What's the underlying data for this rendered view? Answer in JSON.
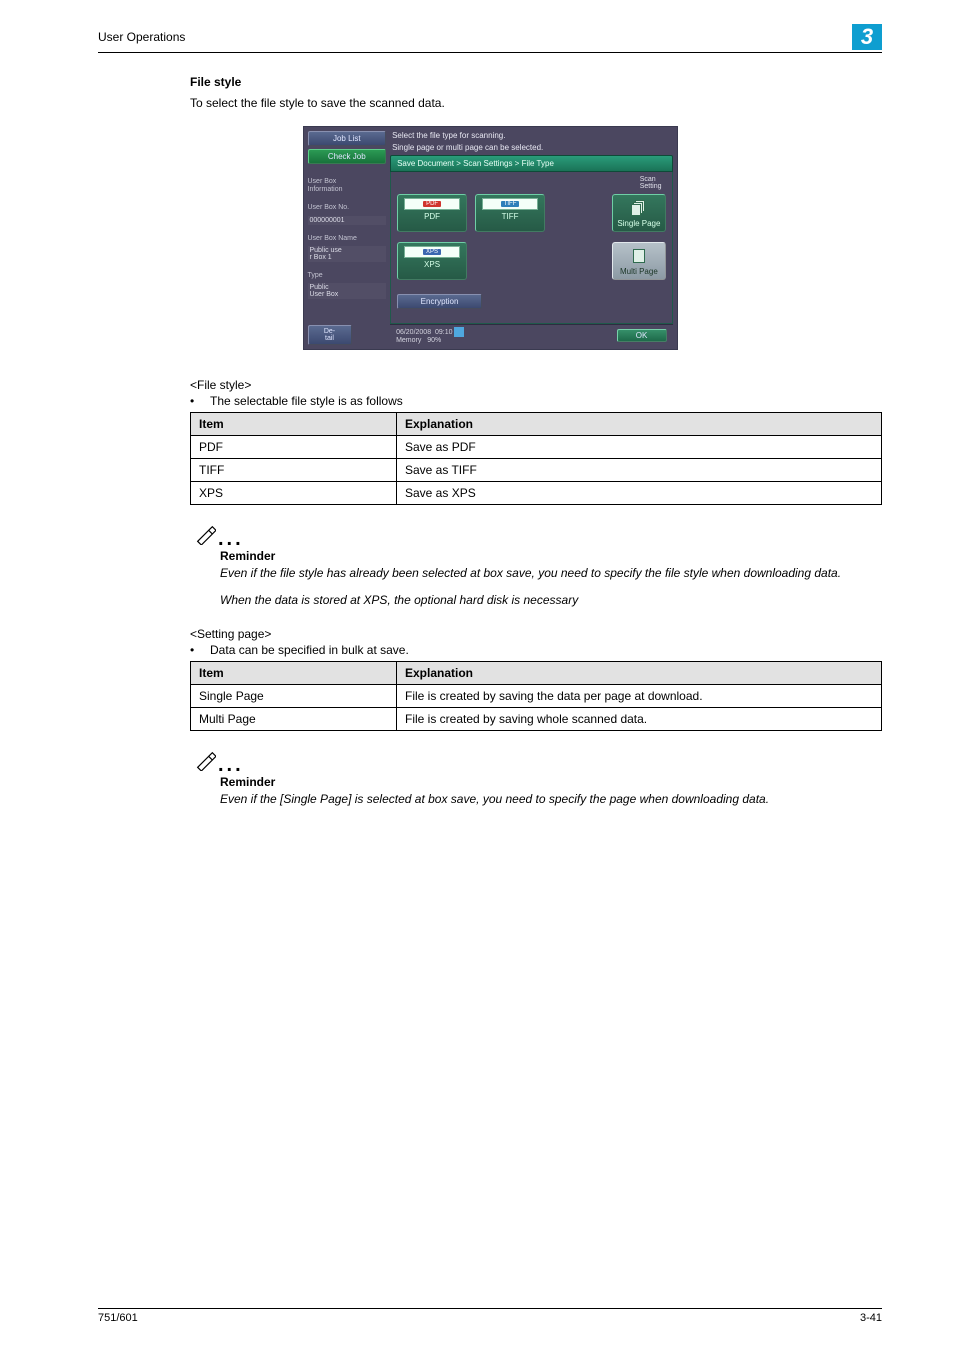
{
  "header": {
    "left": "User Operations",
    "chapter": "3"
  },
  "section": {
    "title": "File style",
    "intro": "To select the file style to save the scanned data."
  },
  "device": {
    "jobList": "Job List",
    "checkJob": "Check Job",
    "userBoxInfo": "User Box\nInformation",
    "userBoxNoLabel": "User Box No.",
    "userBoxNoValue": "000000001",
    "userBoxNameLabel": "User Box Name",
    "userBoxNameValue": "Public use\nr Box 1",
    "typeLabel": "Type",
    "typeValue": "Public\nUser Box",
    "detail": "De-\ntail",
    "instruction1": "Select the file type for scanning.",
    "instruction2": "Single page or multi page can be selected.",
    "crumb": "Save Document > Scan Settings > File Type",
    "scanSetting": "Scan\nSetting",
    "pdf": "PDF",
    "tiff": "TIFF",
    "xps": "XPS",
    "singlePage": "Single Page",
    "multiPage": "Multi Page",
    "encryption": "Encryption",
    "date": "06/20/2008",
    "time": "09:10",
    "memory": "Memory",
    "memoryPct": "90%",
    "ok": "OK"
  },
  "fileStyleSub": "<File style>",
  "fileStyleBullet": "The selectable file style is as follows",
  "table1": {
    "h1": "Item",
    "h2": "Explanation",
    "rows": [
      {
        "item": "PDF",
        "exp": "Save as PDF"
      },
      {
        "item": "TIFF",
        "exp": "Save as TIFF"
      },
      {
        "item": "XPS",
        "exp": "Save as XPS"
      }
    ]
  },
  "reminder1": {
    "title": "Reminder",
    "p1": "Even if the file style has already been selected at box save, you need to specify the file style when downloading data.",
    "p2": "When the data is stored at XPS, the optional hard disk is necessary"
  },
  "settingSub": "<Setting page>",
  "settingBullet": "Data can be specified in bulk at save.",
  "table2": {
    "h1": "Item",
    "h2": "Explanation",
    "rows": [
      {
        "item": "Single Page",
        "exp": "File is created by saving the data per page at download."
      },
      {
        "item": "Multi Page",
        "exp": "File is created by saving whole scanned data."
      }
    ]
  },
  "reminder2": {
    "title": "Reminder",
    "p1": "Even if the [Single Page] is selected at box save, you need to specify the page when downloading data."
  },
  "footer": {
    "left": "751/601",
    "right": "3-41"
  }
}
